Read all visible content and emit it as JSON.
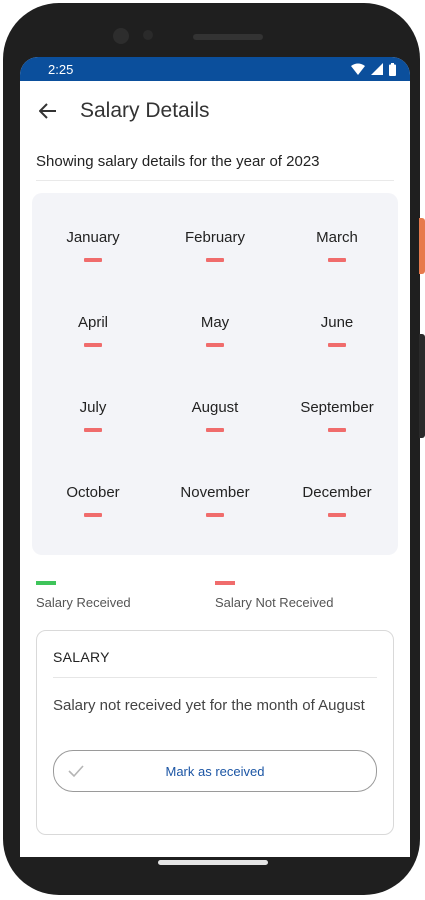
{
  "status_bar": {
    "time": "2:25",
    "icons": [
      "wifi-icon",
      "signal-icon",
      "battery-icon"
    ]
  },
  "app_bar": {
    "back_icon": "arrow-back-icon",
    "title": "Salary Details"
  },
  "subtitle": "Showing salary details for the year of 2023",
  "months": [
    {
      "name": "January",
      "status": "not_received"
    },
    {
      "name": "February",
      "status": "not_received"
    },
    {
      "name": "March",
      "status": "not_received"
    },
    {
      "name": "April",
      "status": "not_received"
    },
    {
      "name": "May",
      "status": "not_received"
    },
    {
      "name": "June",
      "status": "not_received"
    },
    {
      "name": "July",
      "status": "not_received"
    },
    {
      "name": "August",
      "status": "not_received"
    },
    {
      "name": "September",
      "status": "not_received"
    },
    {
      "name": "October",
      "status": "not_received"
    },
    {
      "name": "November",
      "status": "not_received"
    },
    {
      "name": "December",
      "status": "not_received"
    }
  ],
  "legend": {
    "received_label": "Salary Received",
    "not_received_label": "Salary Not Received"
  },
  "colors": {
    "received": "#3ec45a",
    "not_received": "#f06c6c",
    "status_bar": "#0b4f9c",
    "accent_text": "#1b55a4"
  },
  "salary_card": {
    "heading": "SALARY",
    "message": "Salary not received yet for the month of August",
    "button_label": "Mark as received",
    "button_icon": "check-icon"
  }
}
